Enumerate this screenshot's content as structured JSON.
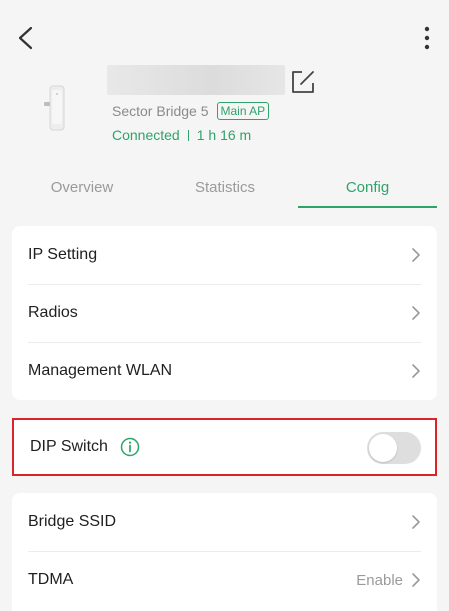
{
  "device": {
    "model": "Sector Bridge 5",
    "role_badge": "Main AP",
    "status": "Connected",
    "uptime": "1 h 16 m"
  },
  "tabs": [
    {
      "label": "Overview",
      "active": false
    },
    {
      "label": "Statistics",
      "active": false
    },
    {
      "label": "Config",
      "active": true
    }
  ],
  "config_group1": [
    {
      "label": "IP Setting"
    },
    {
      "label": "Radios"
    },
    {
      "label": "Management WLAN"
    }
  ],
  "dip_switch": {
    "label": "DIP Switch",
    "enabled": false
  },
  "config_group2": [
    {
      "label": "Bridge SSID",
      "value": ""
    },
    {
      "label": "TDMA",
      "value": "Enable"
    }
  ],
  "colors": {
    "accent": "#2ea36a",
    "highlight_border": "#d9242b",
    "toggle_off": "#dedede"
  },
  "icons": {
    "back": "chevron-left-icon",
    "more": "vertical-dots-icon",
    "edit": "edit-icon",
    "info": "info-circle-icon",
    "chevron": "chevron-right-icon"
  }
}
